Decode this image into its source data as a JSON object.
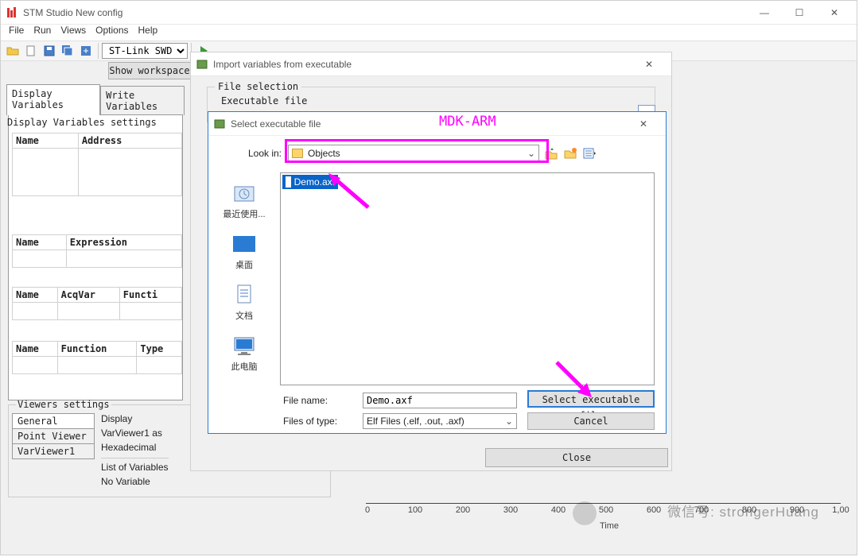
{
  "main": {
    "title": "STM Studio New config",
    "menu": {
      "file": "File",
      "run": "Run",
      "views": "Views",
      "options": "Options",
      "help": "Help"
    },
    "debugger_selected": "ST-Link SWD",
    "show_workspace": "Show workspace"
  },
  "tabs": {
    "display": "Display Variables",
    "write": "Write Variables"
  },
  "dv": {
    "settings_title": "Display Variables settings",
    "t1": {
      "name": "Name",
      "address": "Address"
    },
    "t2": {
      "name": "Name",
      "expression": "Expression"
    },
    "t3": {
      "name": "Name",
      "acqvar": "AcqVar",
      "function": "Functi"
    },
    "t4": {
      "name": "Name",
      "function": "Function",
      "type": "Type"
    }
  },
  "viewers": {
    "title": "Viewers settings",
    "general": "General",
    "point": "Point Viewer",
    "var1": "VarViewer1",
    "display": "Display",
    "var_as": "VarViewer1 as",
    "hex": "Hexadecimal",
    "list": "List of Variables",
    "novar": "No Variable"
  },
  "chart": {
    "xlabel": "Time",
    "ticks": [
      "0",
      "100",
      "200",
      "300",
      "400",
      "500",
      "600",
      "700",
      "800",
      "900",
      "1,00"
    ]
  },
  "import": {
    "title": "Import variables from executable",
    "file_selection": "File selection",
    "exec_file": "Executable file",
    "close": "Close",
    "browse": "..."
  },
  "annotation": {
    "mdk": "MDK-ARM"
  },
  "select": {
    "title": "Select executable file",
    "look_in": "Look in:",
    "folder": "Objects",
    "file": "Demo.axf",
    "places": {
      "recent": "最近使用...",
      "desktop": "桌面",
      "docs": "文档",
      "pc": "此电脑"
    },
    "file_name_lbl": "File name:",
    "file_name_val": "Demo.axf",
    "filter_lbl": "Files of type:",
    "filter_val": "Elf Files (.elf, .out, .axf)",
    "ok": "Select executable file",
    "cancel": "Cancel"
  },
  "watermark": "微信号: strongerHuang"
}
